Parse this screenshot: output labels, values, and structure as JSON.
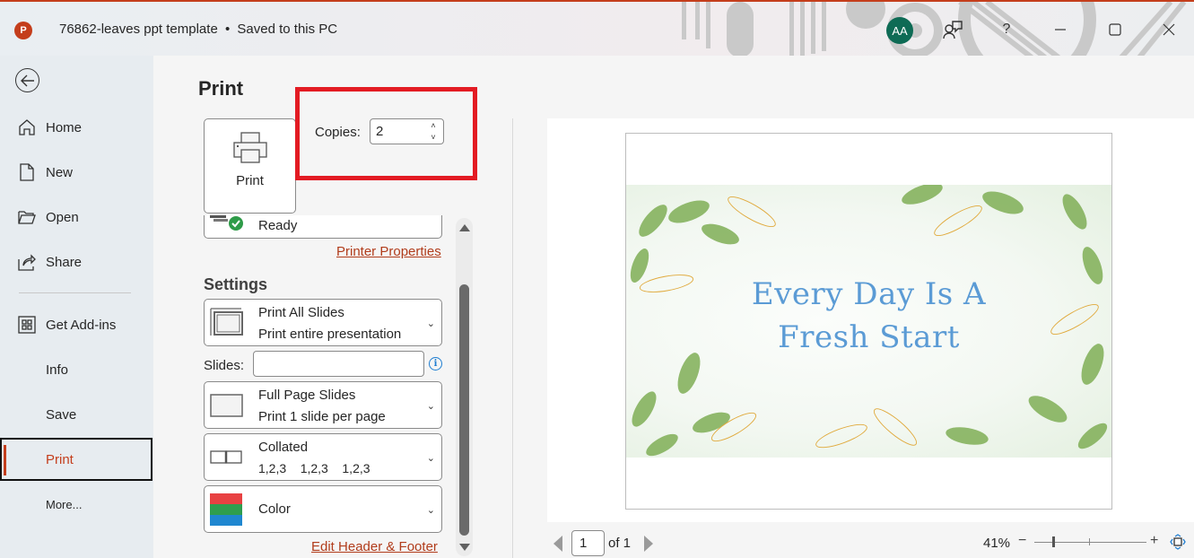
{
  "titlebar": {
    "app_icon_letter": "P",
    "document_title": "76862-leaves ppt template",
    "separator": "•",
    "save_status": "Saved to this PC",
    "user_initials": "AA",
    "accent_color": "#c43e1c"
  },
  "sidebar": {
    "items": [
      {
        "label": "Home",
        "icon": "home-icon"
      },
      {
        "label": "New",
        "icon": "new-document-icon"
      },
      {
        "label": "Open",
        "icon": "folder-open-icon"
      },
      {
        "label": "Share",
        "icon": "share-icon"
      },
      {
        "label": "Get Add-ins",
        "icon": "add-ins-icon"
      },
      {
        "label": "Info"
      },
      {
        "label": "Save"
      },
      {
        "label": "Print",
        "active": true
      },
      {
        "label": "More..."
      }
    ]
  },
  "print": {
    "title": "Print",
    "print_button_label": "Print",
    "copies_label": "Copies:",
    "copies_value": "2",
    "printer_status": "Ready",
    "printer_properties_link": "Printer Properties",
    "highlight_color": "#e31b23"
  },
  "settings": {
    "title": "Settings",
    "slides_range": {
      "line1": "Print All Slides",
      "line2": "Print entire presentation"
    },
    "slides_label": "Slides:",
    "slides_value": "",
    "layout": {
      "line1": "Full Page Slides",
      "line2": "Print 1 slide per page"
    },
    "collation": {
      "line1": "Collated",
      "line2": "1,2,3    1,2,3    1,2,3"
    },
    "color": {
      "line1": "Color",
      "swatch_colors": [
        "#e84142",
        "#2f9e4f",
        "#1f87d0"
      ]
    },
    "edit_header_footer_link": "Edit Header & Footer"
  },
  "preview": {
    "slide_title_line1": "Every Day Is A",
    "slide_title_line2": "Fresh Start",
    "slide_title_color": "#5b9bd5",
    "current_page": "1",
    "page_of": "of 1",
    "zoom_label": "41%",
    "zoom_percent": 41
  }
}
